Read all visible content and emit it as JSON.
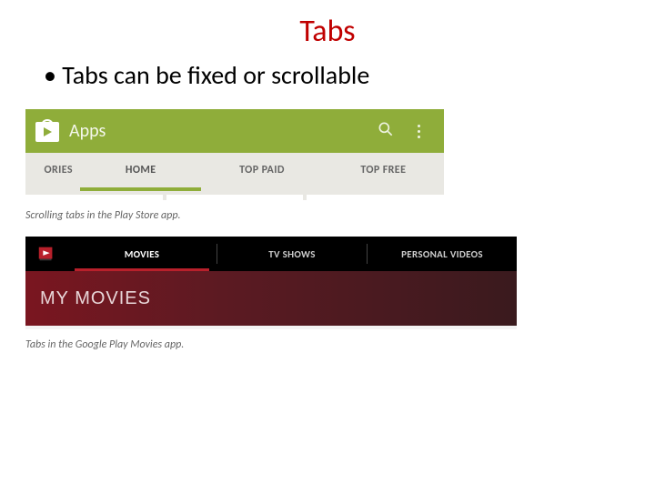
{
  "slide": {
    "title": "Tabs",
    "bullet": "Tabs can be fixed or scrollable"
  },
  "playstore": {
    "header_title": "Apps",
    "tabs": {
      "partial": "ORIES",
      "home": "HOME",
      "top_paid": "TOP PAID",
      "top_free": "TOP FREE"
    },
    "caption": "Scrolling tabs in the Play Store app."
  },
  "movies": {
    "tabs": {
      "movies": "MOVIES",
      "tvshows": "TV SHOWS",
      "personal": "PERSONAL VIDEOS"
    },
    "heading": "MY MOVIES",
    "caption": "Tabs in the Google Play Movies app."
  }
}
